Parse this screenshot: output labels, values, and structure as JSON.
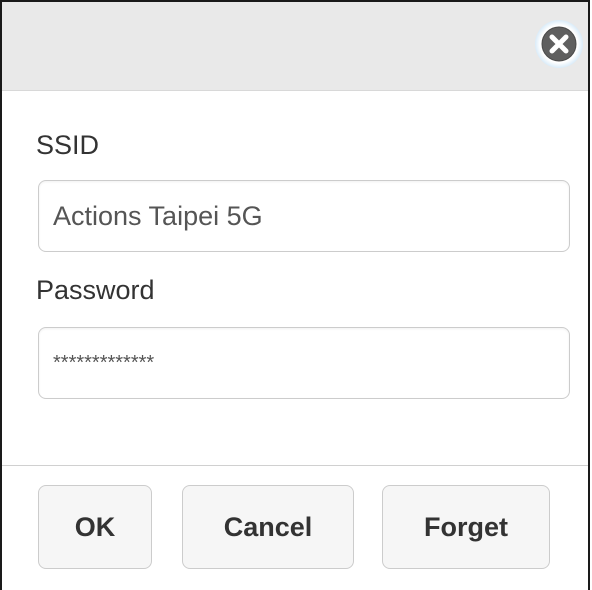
{
  "dialog": {
    "close_icon": "close-circle-icon"
  },
  "form": {
    "ssid_label": "SSID",
    "ssid_value": "Actions Taipei 5G",
    "password_label": "Password",
    "password_value": "*************"
  },
  "buttons": {
    "ok_label": "OK",
    "cancel_label": "Cancel",
    "forget_label": "Forget"
  },
  "colors": {
    "titlebar": "#e9e9e9",
    "button_bg": "#f6f6f6",
    "close_glow": "#9fcdee"
  }
}
